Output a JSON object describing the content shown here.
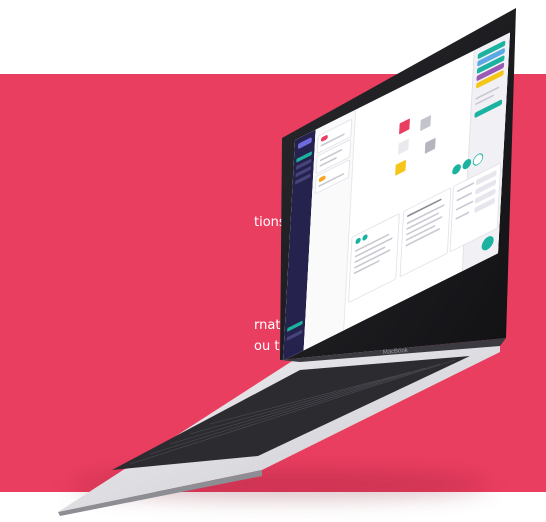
{
  "background": {
    "band_color": "#ea3e60",
    "page_color": "#ffffff"
  },
  "text_fragments": {
    "line1": "tions to drive",
    "line2": "rnatively,",
    "line3": "ou through a"
  },
  "laptop": {
    "brand_label": "MacBook",
    "screen_app": {
      "sidebar_color": "#25234d",
      "accent_color": "#1bb3a0",
      "secondary_accent": "#ea3e60",
      "highlight_color": "#f5c518"
    }
  },
  "icons": [
    "laptop-icon",
    "chat-bubble-icon"
  ]
}
